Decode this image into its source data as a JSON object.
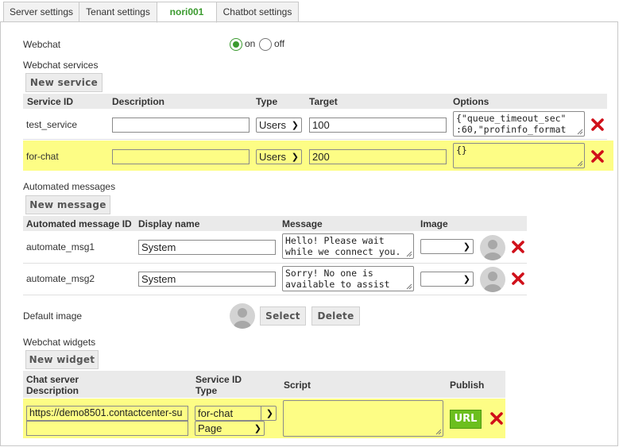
{
  "tabs": [
    {
      "label": "Server settings",
      "active": false
    },
    {
      "label": "Tenant settings",
      "active": false
    },
    {
      "label": "nori001",
      "active": true
    },
    {
      "label": "Chatbot settings",
      "active": false
    }
  ],
  "webchat": {
    "label": "Webchat",
    "on_label": "on",
    "off_label": "off",
    "enabled": true
  },
  "services": {
    "section_label": "Webchat services",
    "new_button": "New service",
    "headers": {
      "id": "Service ID",
      "description": "Description",
      "type": "Type",
      "target": "Target",
      "options": "Options"
    },
    "rows": [
      {
        "id": "test_service",
        "description": "",
        "type": "Users",
        "target": "100",
        "options": "{\"queue_timeout_sec\"\n:60,\"profinfo_format",
        "highlighted": false
      },
      {
        "id": "for-chat",
        "description": "",
        "type": "Users",
        "target": "200",
        "options": "{}",
        "highlighted": true
      }
    ]
  },
  "automated": {
    "section_label": "Automated messages",
    "new_button": "New message",
    "headers": {
      "id": "Automated message ID",
      "display_name": "Display name",
      "message": "Message",
      "image": "Image"
    },
    "rows": [
      {
        "id": "automate_msg1",
        "display_name": "System",
        "message": "Hello! Please wait\nwhile we connect you.",
        "image": ""
      },
      {
        "id": "automate_msg2",
        "display_name": "System",
        "message": "Sorry! No one is\navailable to assist",
        "image": ""
      }
    ]
  },
  "default_image": {
    "label": "Default image",
    "select_button": "Select",
    "delete_button": "Delete"
  },
  "widgets": {
    "section_label": "Webchat widgets",
    "new_button": "New widget",
    "headers": {
      "server": "Chat server",
      "description": "Description",
      "service_id": "Service ID",
      "type": "Type",
      "script": "Script",
      "publish": "Publish"
    },
    "rows": [
      {
        "server": "https://demo8501.contactcenter-su",
        "description": "",
        "service_id": "for-chat",
        "type": "Page",
        "script": "",
        "publish_label": "URL"
      }
    ]
  },
  "colors": {
    "accent_green": "#3a9a2e",
    "highlight": "#fdfd85",
    "delete_red": "#d0101a",
    "url_button": "#6cbf1e"
  }
}
